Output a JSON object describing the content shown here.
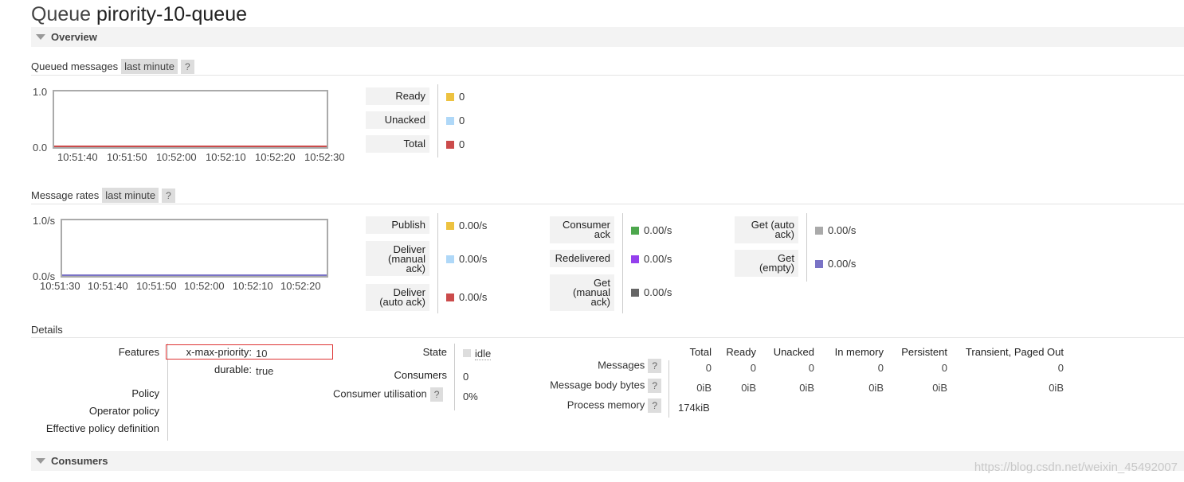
{
  "page": {
    "title_prefix": "Queue",
    "queue_name": "pirority-10-queue"
  },
  "overview": {
    "label": "Overview"
  },
  "queued": {
    "label": "Queued messages",
    "range": "last minute",
    "help": "?",
    "y_top": "1.0",
    "y_bottom": "0.0",
    "x_ticks": [
      "10:51:40",
      "10:51:50",
      "10:52:00",
      "10:52:10",
      "10:52:20",
      "10:52:30"
    ],
    "legend": [
      {
        "label": "Ready",
        "value": "0",
        "color": "#edc240"
      },
      {
        "label": "Unacked",
        "value": "0",
        "color": "#afd8f8"
      },
      {
        "label": "Total",
        "value": "0",
        "color": "#cb4b4b"
      }
    ]
  },
  "rates": {
    "label": "Message rates",
    "range": "last minute",
    "help": "?",
    "y_top": "1.0/s",
    "y_bottom": "0.0/s",
    "x_ticks": [
      "10:51:30",
      "10:51:40",
      "10:51:50",
      "10:52:00",
      "10:52:10",
      "10:52:20"
    ],
    "col1": [
      {
        "label": "Publish",
        "value": "0.00/s",
        "color": "#edc240"
      },
      {
        "label": "Deliver (manual ack)",
        "l1": "Deliver",
        "l2": "(manual",
        "l3": "ack)",
        "value": "0.00/s",
        "color": "#afd8f8"
      },
      {
        "label": "Deliver (auto ack)",
        "l1": "Deliver",
        "l2": "(auto ack)",
        "value": "0.00/s",
        "color": "#cb4b4b"
      }
    ],
    "col2": [
      {
        "label": "Consumer ack",
        "l1": "Consumer",
        "l2": "ack",
        "value": "0.00/s",
        "color": "#4da74d"
      },
      {
        "label": "Redelivered",
        "value": "0.00/s",
        "color": "#9440ed"
      },
      {
        "label": "Get (manual ack)",
        "l1": "Get",
        "l2": "(manual",
        "l3": "ack)",
        "value": "0.00/s",
        "color": "#666666"
      }
    ],
    "col3": [
      {
        "label": "Get (auto ack)",
        "l1": "Get (auto",
        "l2": "ack)",
        "value": "0.00/s",
        "color": "#aaaaaa"
      },
      {
        "label": "Get (empty)",
        "l1": "Get",
        "l2": "(empty)",
        "value": "0.00/s",
        "color": "#7a73c6"
      }
    ]
  },
  "details": {
    "label": "Details",
    "features_label": "Features",
    "features": [
      {
        "key": "x-max-priority:",
        "value": "10"
      },
      {
        "key": "durable:",
        "value": "true"
      }
    ],
    "policy_label": "Policy",
    "operator_policy_label": "Operator policy",
    "effective_policy_label": "Effective policy definition",
    "state_label": "State",
    "state_value": "idle",
    "consumers_label": "Consumers",
    "consumers_value": "0",
    "utilisation_label": "Consumer utilisation",
    "utilisation_help": "?",
    "utilisation_value": "0%",
    "stats_headers": [
      "Total",
      "Ready",
      "Unacked",
      "In memory",
      "Persistent",
      "Transient, Paged Out"
    ],
    "messages_label": "Messages",
    "messages_help": "?",
    "messages_values": [
      "0",
      "0",
      "0",
      "0",
      "0",
      "0"
    ],
    "body_label": "Message body bytes",
    "body_help": "?",
    "body_values": [
      "0iB",
      "0iB",
      "0iB",
      "0iB",
      "0iB",
      "0iB"
    ],
    "process_memory_label": "Process memory",
    "process_memory_help": "?",
    "process_memory_value": "174kiB"
  },
  "consumers_section": {
    "label": "Consumers"
  },
  "watermark": "https://blog.csdn.net/weixin_45492007"
}
